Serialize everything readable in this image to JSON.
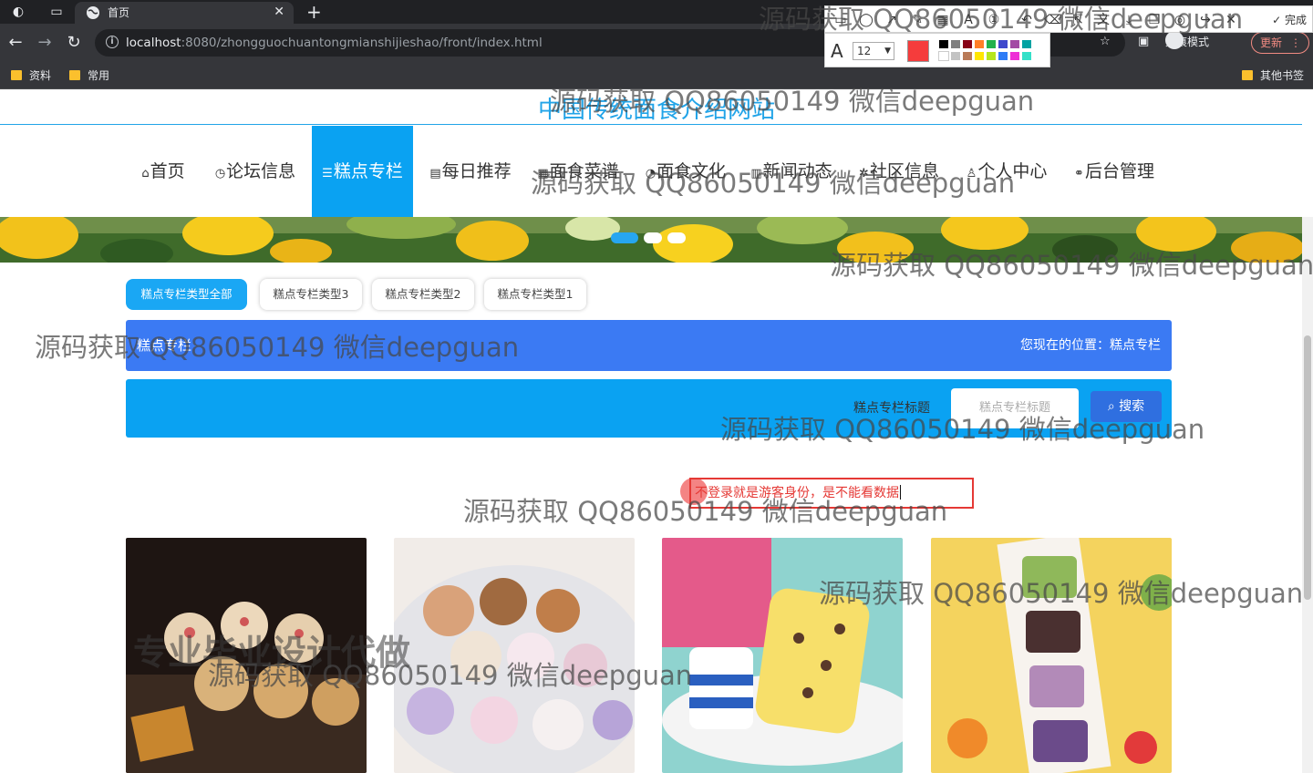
{
  "browser": {
    "tab_title": "首页",
    "url_host": "localhost",
    "url_path": ":8080/zhongguochuantongmianshijieshao/front/index.html",
    "incognito_label": "无痕模式",
    "update_label": "更新",
    "bookmarks": [
      "资料",
      "常用"
    ],
    "other_bookmarks": "其他书签"
  },
  "annotation_toolbar": {
    "done_label": "完成",
    "font_size": "12",
    "current_color": "#f53c3c"
  },
  "site": {
    "title": "中国传统面食介绍网站",
    "nav": [
      {
        "icon": "⌂",
        "label": "首页"
      },
      {
        "icon": "◷",
        "label": "论坛信息"
      },
      {
        "icon": "☰",
        "label": "糕点专栏"
      },
      {
        "icon": "▤",
        "label": "每日推荐"
      },
      {
        "icon": "▦",
        "label": "面食菜谱"
      },
      {
        "icon": "◔",
        "label": "面食文化"
      },
      {
        "icon": "▥",
        "label": "新闻动态"
      },
      {
        "icon": "✲",
        "label": "社区信息"
      },
      {
        "icon": "♙",
        "label": "个人中心"
      },
      {
        "icon": "⚭",
        "label": "后台管理"
      }
    ],
    "active_nav": "糕点专栏",
    "accent_color": "#0aa2f2"
  },
  "filters": [
    "糕点专栏类型全部",
    "糕点专栏类型3",
    "糕点专栏类型2",
    "糕点专栏类型1"
  ],
  "breadcrumb": {
    "title": "糕点专栏",
    "position_label": "您现在的位置：",
    "position_value": "糕点专栏"
  },
  "search": {
    "label": "糕点专栏标题",
    "placeholder": "糕点专栏标题",
    "button": "搜索"
  },
  "notice": "不登录就是游客身份，是不能看数据",
  "watermarks": {
    "contact": "源码获取 QQ86050149 微信deepguan",
    "promo": "专业毕业设计代做"
  }
}
